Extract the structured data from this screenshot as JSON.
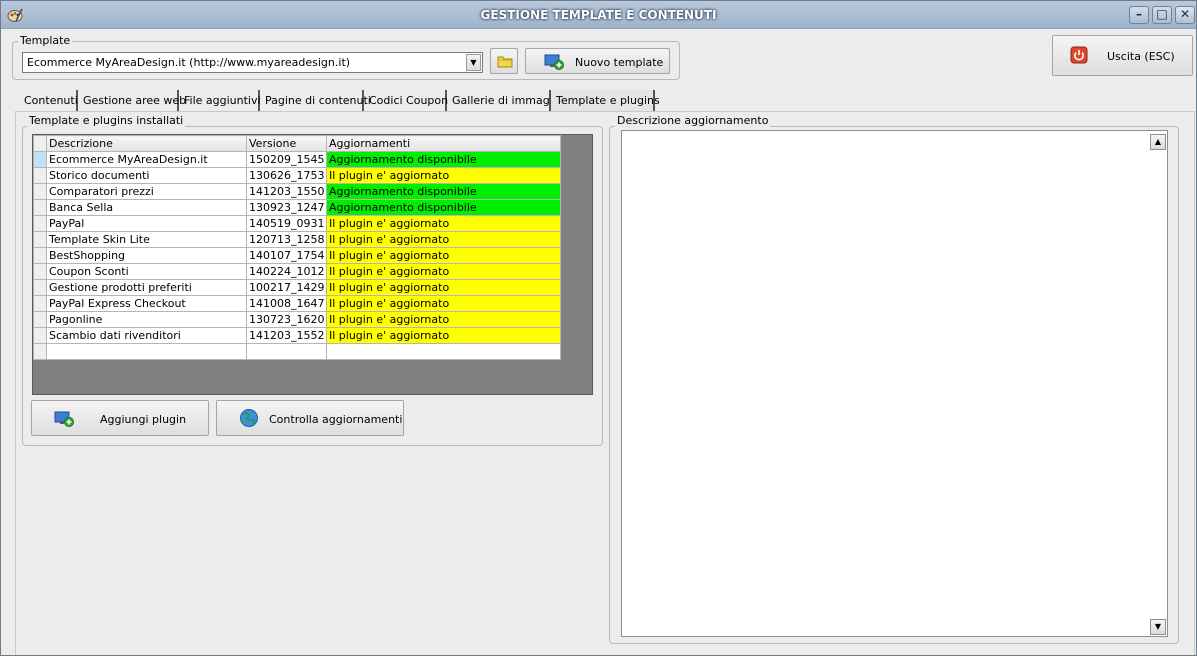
{
  "window": {
    "title": "GESTIONE TEMPLATE E CONTENUTI",
    "app_icon": "palette-icon",
    "controls": [
      "minimize-icon",
      "maximize-icon",
      "close-icon"
    ]
  },
  "template_group": {
    "label": "Template",
    "selected": "Ecommerce MyAreaDesign.it (http://www.myareadesign.it)",
    "folder_icon": "folder-icon",
    "new_button": "Nuovo template"
  },
  "exit_button": {
    "label": "Uscita (ESC)",
    "icon": "power-icon"
  },
  "tabs": [
    {
      "label": "Contenuti"
    },
    {
      "label": "Gestione aree web"
    },
    {
      "label": "File aggiuntivi"
    },
    {
      "label": "Pagine di contenuti"
    },
    {
      "label": "Codici Coupon"
    },
    {
      "label": "Gallerie di immagini"
    },
    {
      "label": "Template e plugins",
      "active": true
    }
  ],
  "installed": {
    "label": "Template e plugins installati",
    "columns": [
      "Descrizione",
      "Versione",
      "Aggiornamenti"
    ],
    "rows": [
      {
        "descrizione": "Ecommerce MyAreaDesign.it",
        "versione": "150209_1545",
        "aggiornamenti": "Aggiornamento disponibile",
        "status": "new"
      },
      {
        "descrizione": "Storico documenti",
        "versione": "130626_1753",
        "aggiornamenti": "Il plugin e' aggiornato",
        "status": "ok"
      },
      {
        "descrizione": "Comparatori prezzi",
        "versione": "141203_1550",
        "aggiornamenti": "Aggiornamento disponibile",
        "status": "new"
      },
      {
        "descrizione": "Banca Sella",
        "versione": "130923_1247",
        "aggiornamenti": "Aggiornamento disponibile",
        "status": "new"
      },
      {
        "descrizione": "PayPal",
        "versione": "140519_0931",
        "aggiornamenti": "Il plugin e' aggiornato",
        "status": "ok"
      },
      {
        "descrizione": "Template Skin Lite",
        "versione": "120713_1258",
        "aggiornamenti": "Il plugin e' aggiornato",
        "status": "ok"
      },
      {
        "descrizione": "BestShopping",
        "versione": "140107_1754",
        "aggiornamenti": "Il plugin e' aggiornato",
        "status": "ok"
      },
      {
        "descrizione": "Coupon Sconti",
        "versione": "140224_1012",
        "aggiornamenti": "Il plugin e' aggiornato",
        "status": "ok"
      },
      {
        "descrizione": "Gestione prodotti preferiti",
        "versione": "100217_1429",
        "aggiornamenti": "Il plugin e' aggiornato",
        "status": "ok"
      },
      {
        "descrizione": "PayPal Express Checkout",
        "versione": "141008_1647",
        "aggiornamenti": "Il plugin e' aggiornato",
        "status": "ok"
      },
      {
        "descrizione": "Pagonline",
        "versione": "130723_1620",
        "aggiornamenti": "Il plugin e' aggiornato",
        "status": "ok"
      },
      {
        "descrizione": "Scambio dati rivenditori",
        "versione": "141203_1552",
        "aggiornamenti": "Il plugin e' aggiornato",
        "status": "ok"
      }
    ],
    "add_button": "Aggiungi plugin",
    "check_button": "Controlla aggiornamenti"
  },
  "description": {
    "label": "Descrizione aggiornamento",
    "value": ""
  },
  "colors": {
    "update_available": "#00ee00",
    "up_to_date": "#ffff00",
    "titlebar": "#a9bcd2"
  }
}
